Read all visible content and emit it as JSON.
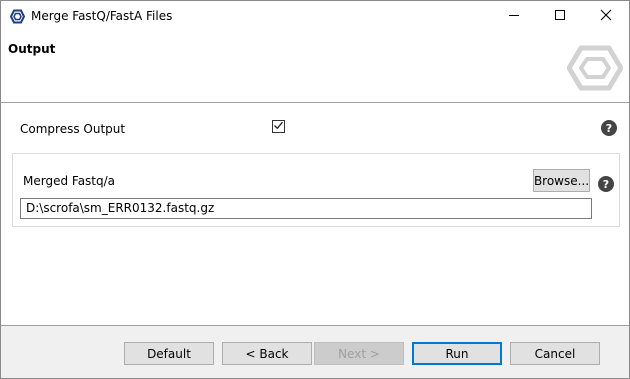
{
  "window": {
    "title": "Merge FastQ/FastA Files",
    "app_icon": "hexagon-app-icon",
    "controls": [
      "minimize-icon",
      "maximize-icon",
      "close-icon"
    ]
  },
  "header": {
    "title": "Output",
    "logo_icon": "hexagon-logo-icon"
  },
  "form": {
    "compress": {
      "label": "Compress Output",
      "checked": true
    },
    "merged": {
      "label": "Merged Fastq/a",
      "browse_label": "Browse...",
      "value": "D:\\scrofa\\sm_ERR0132.fastq.gz"
    },
    "help_glyph": "?"
  },
  "footer": {
    "default_label": "Default",
    "back_label": "< Back",
    "next_label": "Next >",
    "run_label": "Run",
    "cancel_label": "Cancel"
  },
  "colors": {
    "accent": "#0078d7",
    "help_bg": "#454545",
    "footer_bg": "#f0f0f0"
  }
}
